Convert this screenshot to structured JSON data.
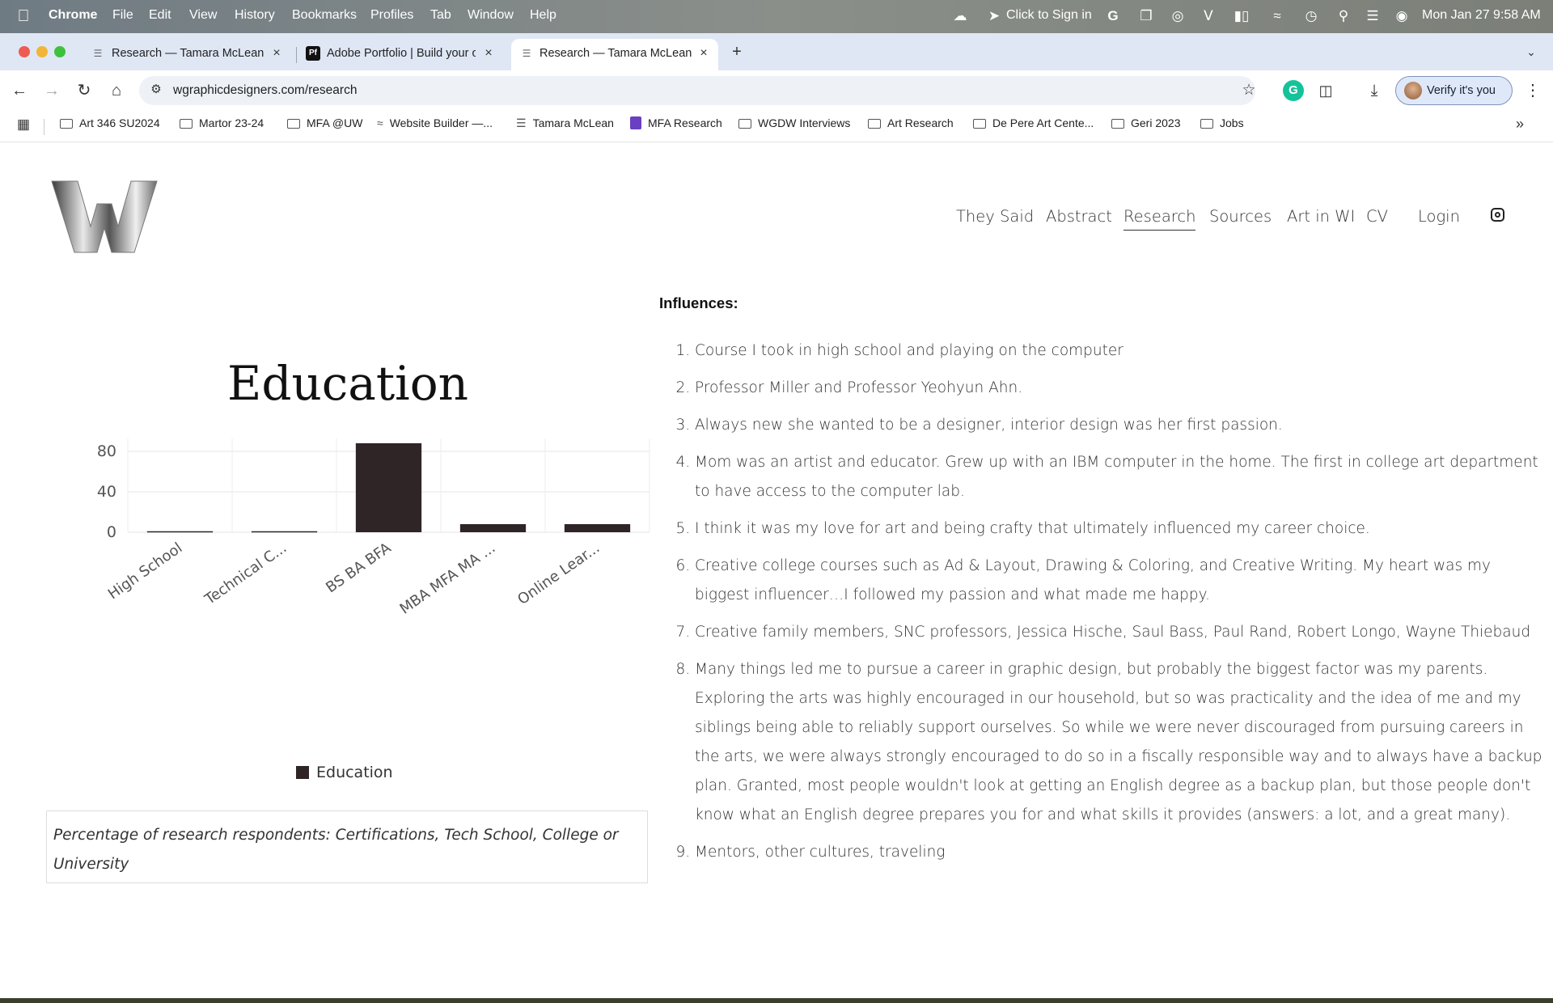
{
  "menubar": {
    "app": "Chrome",
    "menus": [
      "File",
      "Edit",
      "View",
      "History",
      "Bookmarks",
      "Profiles",
      "Tab",
      "Window",
      "Help"
    ],
    "status_text": "Click to Sign in",
    "datetime": "Mon Jan 27  9:58 AM"
  },
  "tabs": [
    {
      "label": "Research — Tamara McLean",
      "favicon": "site-icon"
    },
    {
      "label": "Adobe Portfolio | Build your o",
      "favicon": "Pf"
    },
    {
      "label": "Research — Tamara McLean",
      "favicon": "site-icon"
    }
  ],
  "toolbar": {
    "url": "wgraphicdesigners.com/research",
    "verify_label": "Verify it's you"
  },
  "bookmarks": [
    {
      "label": "Art 346 SU2024",
      "icon": "folder-icon"
    },
    {
      "label": "Martor 23-24",
      "icon": "folder-icon"
    },
    {
      "label": "MFA @UW",
      "icon": "folder-icon"
    },
    {
      "label": "Website Builder —...",
      "icon": "site-icon"
    },
    {
      "label": "Tamara McLean",
      "icon": "site-icon"
    },
    {
      "label": "MFA Research",
      "icon": "forms-icon"
    },
    {
      "label": "WGDW Interviews",
      "icon": "folder-icon"
    },
    {
      "label": "Art Research",
      "icon": "folder-icon"
    },
    {
      "label": "De Pere Art Cente...",
      "icon": "folder-icon"
    },
    {
      "label": "Geri 2023",
      "icon": "folder-icon"
    },
    {
      "label": "Jobs",
      "icon": "folder-icon"
    }
  ],
  "site_nav": [
    {
      "label": "They Said"
    },
    {
      "label": "Abstract"
    },
    {
      "label": "Research",
      "active": true
    },
    {
      "label": "Sources"
    },
    {
      "label": "Art in WI"
    },
    {
      "label": "CV"
    },
    {
      "label": "Login"
    }
  ],
  "chart_data": {
    "type": "bar",
    "title": "Education",
    "categories": [
      "High School",
      "Technical C...",
      "BS BA BFA",
      "MBA MFA MA ...",
      "Online Lear..."
    ],
    "series": [
      {
        "name": "Education",
        "values": [
          1,
          1,
          88,
          8,
          8
        ]
      }
    ],
    "yticks": [
      0,
      40,
      80
    ],
    "ylim": [
      0,
      88
    ],
    "grid": true,
    "legend": "bottom",
    "bar_color": "#2f2426",
    "caption": "Percentage of research respondents: Certifications, Tech School, College or University"
  },
  "influences": {
    "heading": "Influences:",
    "items": [
      "Course I took in high school and playing on the computer",
      "Professor Miller and Professor Yeohyun Ahn.",
      "Always new she wanted to be a designer, interior design was her first passion.",
      "Mom was an artist and educator. Grew up with an IBM computer in the home. The first in college art department to have access to the computer lab.",
      "I think it was my love for art and being crafty that ultimately influenced my career choice.",
      "Creative college courses such as Ad & Layout, Drawing & Coloring, and Creative Writing. My heart was my biggest influencer…I followed my passion and what made me happy.",
      "Creative family members, SNC professors, Jessica Hische, Saul Bass, Paul Rand, Robert Longo, Wayne Thiebaud",
      "Many things led me to pursue a career in graphic design, but probably the biggest factor was my parents. Exploring the arts was highly encouraged in our household, but so was practicality and the idea of me and my siblings being able to reliably support ourselves. So while we were never discouraged from pursuing careers in the arts, we were always strongly encouraged to do so in a fiscally responsible way and to always have a backup plan. Granted, most people wouldn't look at getting an English degree as a backup plan, but those people don't know what an English degree prepares you for and what skills it provides (answers: a lot, and a great many).",
      "Mentors, other cultures, traveling"
    ]
  }
}
